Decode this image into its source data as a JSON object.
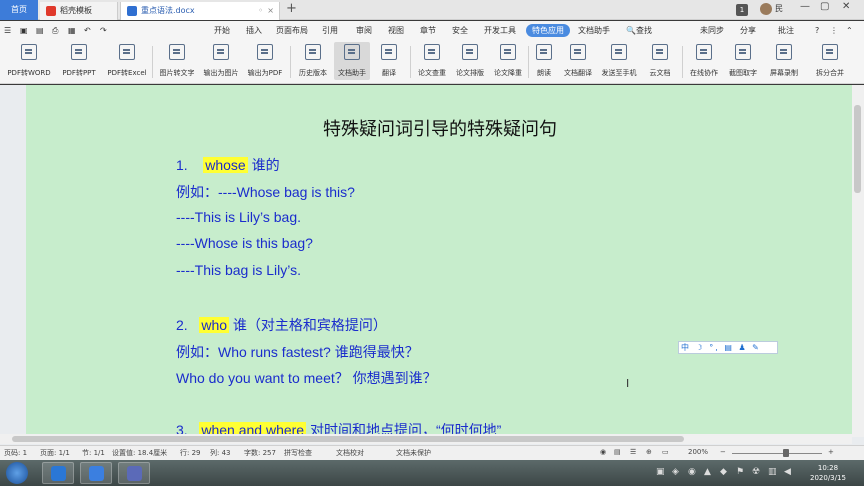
{
  "tabs": {
    "home": "首页",
    "template": "稻壳模板",
    "document": "重点语法.docx",
    "new_tab": "+"
  },
  "user": {
    "name": "民",
    "badge": "1"
  },
  "menu": [
    "开始",
    "插入",
    "页面布局",
    "引用",
    "审阅",
    "视图",
    "章节",
    "安全",
    "开发工具",
    "特色应用",
    "文档助手",
    "查找"
  ],
  "menu_right": [
    "未同步",
    "分享",
    "批注"
  ],
  "toolbar": [
    "PDF转WORD",
    "PDF转PPT",
    "PDF转Excel",
    "图片转文字",
    "输出为图片",
    "输出为PDF",
    "历史版本",
    "文档助手",
    "翻译",
    "论文查重",
    "论文排版",
    "论文降重",
    "朗读",
    "文档翻译",
    "发送至手机",
    "云文档",
    "在线协作",
    "截图取字",
    "屏幕录制",
    "拆分合并"
  ],
  "document": {
    "title": "特殊疑问词引导的特殊疑问句",
    "lines": [
      {
        "num": "1.",
        "word": "whose",
        "rest": " 谁的"
      },
      {
        "text": "例如：----Whose bag is this?"
      },
      {
        "text": "----This is Lily’s bag."
      },
      {
        "text": "----Whose is this bag?"
      },
      {
        "text": "----This bag is Lily’s."
      },
      {
        "num": "2.",
        "word": "who",
        "rest": " 谁（对主格和宾格提问）"
      },
      {
        "text": "例如：Who runs fastest? 谁跑得最快？"
      },
      {
        "text": "Who do you want to meet？ 你想遇到谁？"
      },
      {
        "num": "3.",
        "word": "when and where",
        "rest": " 对时间和地点提问，“何时何地”"
      }
    ]
  },
  "ime_bar": "中 ☽ °, ▤ ♟ ✎",
  "status": {
    "page": "页码: 1",
    "pages": "页面: 1/1",
    "section": "节: 1/1",
    "setting": "设置值: 18.4厘米",
    "row": "行: 29",
    "col": "列: 43",
    "words": "字数: 257",
    "spell": "拼写检查",
    "proof": "文档校对",
    "protect": "文档未保护",
    "zoom": "200%"
  },
  "clock": {
    "time": "10:28",
    "date": "2020/3/15"
  }
}
